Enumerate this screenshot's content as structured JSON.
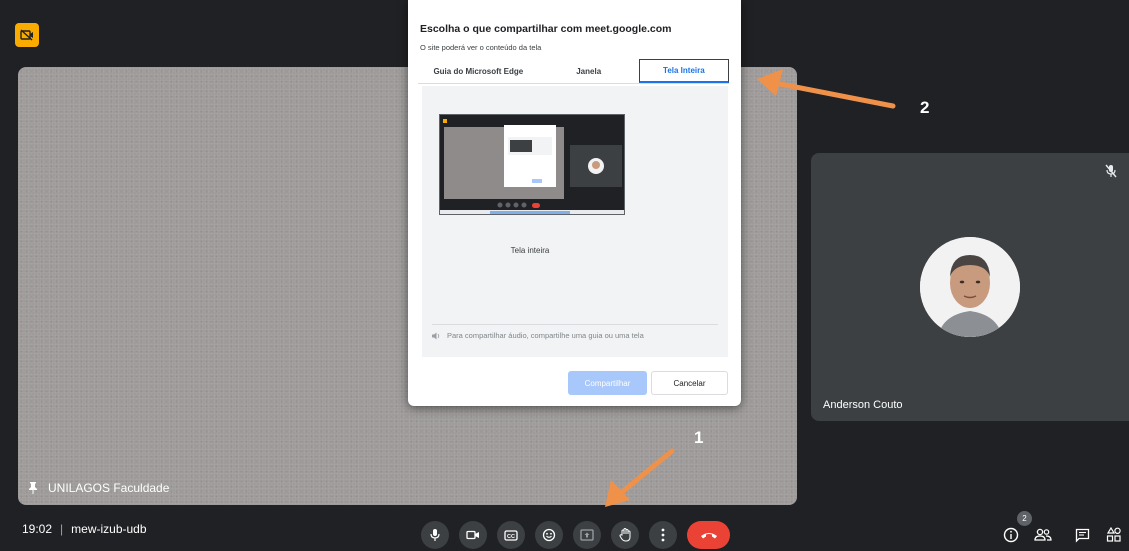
{
  "dialog": {
    "title": "Escolha o que compartilhar com meet.google.com",
    "subtitle": "O site poderá ver o conteúdo da tela",
    "tabs": [
      {
        "label": "Guia do Microsoft Edge"
      },
      {
        "label": "Janela"
      },
      {
        "label": "Tela Inteira",
        "selected": true
      }
    ],
    "thumbnail_caption": "Tela inteira",
    "audio_note": "Para compartilhar áudio, compartilhe uma guia ou uma tela",
    "share_label": "Compartilhar",
    "cancel_label": "Cancelar"
  },
  "main_tile": {
    "label": "UNILAGOS Faculdade"
  },
  "participant": {
    "name": "Anderson Couto",
    "muted": true
  },
  "meeting": {
    "time": "19:02",
    "separator": "|",
    "code": "mew-izub-udb"
  },
  "controls": [
    "mic-icon",
    "camera-icon",
    "captions-icon",
    "emoji-icon",
    "present-screen-icon",
    "raise-hand-icon",
    "more-options-icon",
    "end-call-icon"
  ],
  "right_controls": {
    "people_count": "2"
  },
  "annotations": {
    "first": "1",
    "second": "2"
  },
  "colors": {
    "accent": "#1a73e8",
    "end_call": "#ea4335",
    "badge": "#f9ab00",
    "arrow": "#f0914a",
    "share_disabled": "#a8c7fa"
  }
}
